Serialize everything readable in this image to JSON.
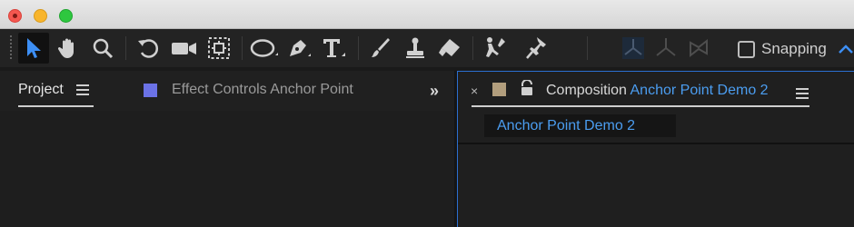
{
  "window": {
    "controls": [
      "close",
      "minimize",
      "zoom"
    ]
  },
  "toolbar": {
    "tools": [
      {
        "icon": "selection-arrow-icon",
        "active": true
      },
      {
        "icon": "hand-icon"
      },
      {
        "icon": "zoom-icon"
      },
      {
        "icon": "rotate-icon"
      },
      {
        "icon": "camera-icon"
      },
      {
        "icon": "pan-behind-icon"
      },
      {
        "icon": "ellipse-icon"
      },
      {
        "icon": "pen-icon"
      },
      {
        "icon": "type-icon"
      },
      {
        "icon": "brush-icon"
      },
      {
        "icon": "clone-stamp-icon"
      },
      {
        "icon": "eraser-icon"
      },
      {
        "icon": "roto-brush-icon"
      },
      {
        "icon": "puppet-pin-icon"
      },
      {
        "icon": "axis-local-icon"
      },
      {
        "icon": "axis-world-icon"
      },
      {
        "icon": "axis-view-icon"
      }
    ],
    "snapping_label": "Snapping",
    "snapping_checked": false
  },
  "left_panel": {
    "tabs": [
      {
        "label": "Project",
        "active": true
      },
      {
        "label": "Effect Controls Anchor Point",
        "active": false,
        "swatch_color": "#6b72e6"
      }
    ],
    "overflow_label": "»"
  },
  "right_panel": {
    "tab": {
      "close_label": "×",
      "swatch_color": "#b29e7d",
      "label_prefix": "Composition",
      "label_name": "Anchor Point Demo 2"
    },
    "breadcrumb": "Anchor Point Demo 2"
  },
  "colors": {
    "accent_blue": "#4b9df0",
    "panel_border_blue": "#2b6fd0"
  }
}
